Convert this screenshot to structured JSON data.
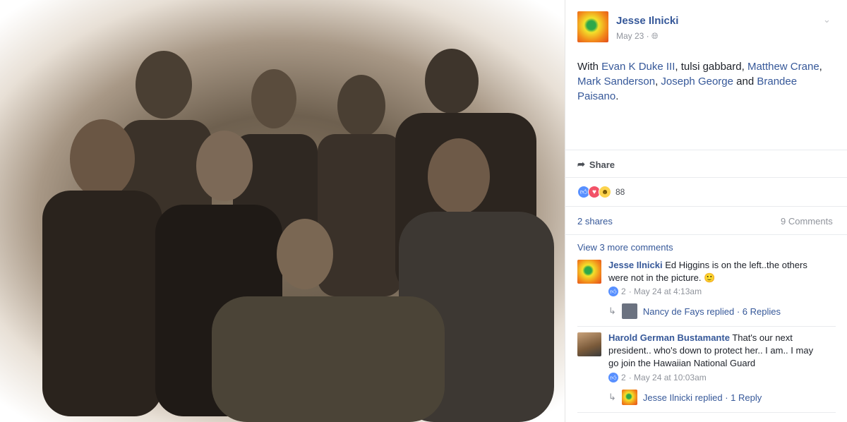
{
  "post": {
    "author": "Jesse Ilnicki",
    "date": "May 23 ·",
    "globe_icon": "globe-icon",
    "with_prefix": "With ",
    "tag1": "Evan K Duke III",
    "sep1": ", tulsi gabbard, ",
    "tag2": "Matthew Crane",
    "sep2": ", ",
    "tag3": "Mark Sanderson",
    "sep3": ", ",
    "tag4": "Joseph George",
    "sep4": " and ",
    "tag5": "Brandee Paisano",
    "end": "."
  },
  "actions": {
    "share_label": "Share"
  },
  "reactions": {
    "count": "88",
    "icons": [
      "like-icon",
      "love-icon",
      "haha-icon"
    ]
  },
  "stats": {
    "shares": "2 shares",
    "comments": "9 Comments"
  },
  "view_more": "View 3 more comments",
  "comments": [
    {
      "author": "Jesse Ilnicki",
      "text": " Ed Higgins is on the left..the others were not in the picture. 🙂",
      "likes": "2",
      "meta": "· May 24 at 4:13am",
      "reply_author": "Nancy de Fays",
      "reply_text": " replied · 6 Replies"
    },
    {
      "author": "Harold German Bustamante",
      "text": " That's our next president.. who's down to protect her.. I am.. I may go join the Hawaiian National Guard",
      "likes": "2",
      "meta": "· May 24 at 10:03am",
      "reply_author": "Jesse Ilnicki",
      "reply_text": " replied · 1 Reply"
    }
  ],
  "colors": {
    "link": "#365899",
    "text": "#1d2129",
    "meta": "#90949c",
    "like": "#5890ff"
  }
}
